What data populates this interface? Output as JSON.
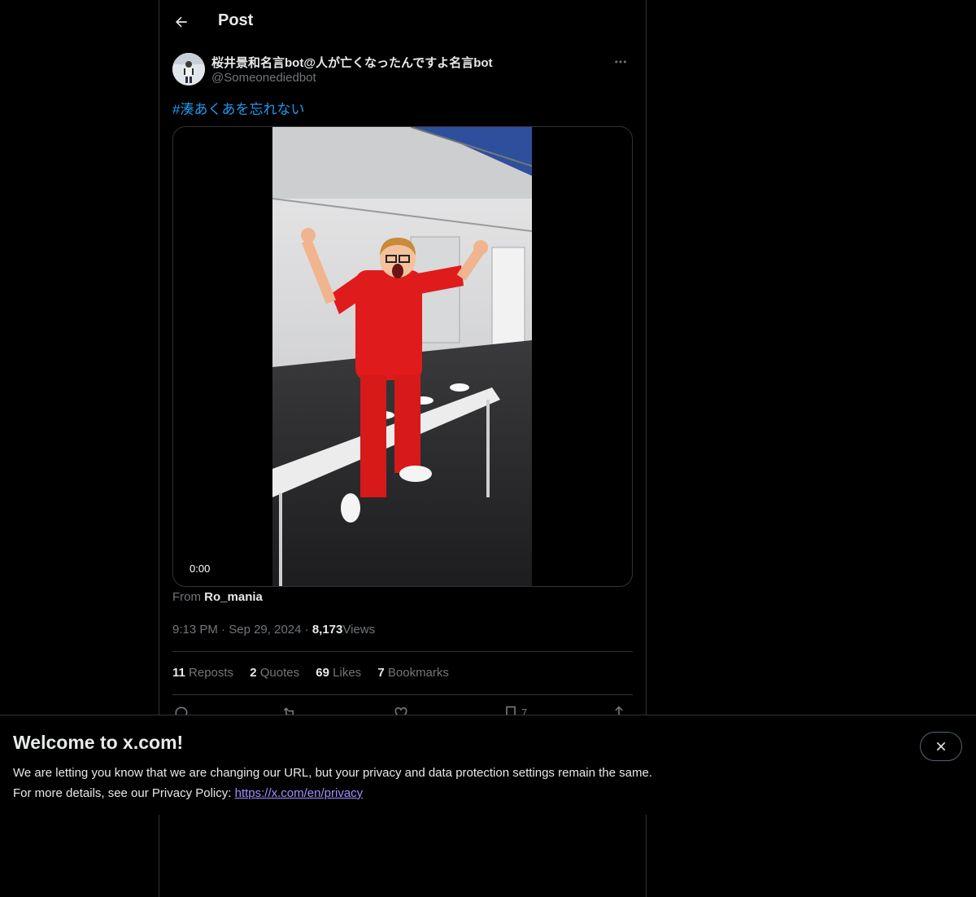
{
  "header": {
    "title": "Post"
  },
  "post": {
    "author_name": "桜井景和名言bot@人が亡くなったんですよ名言bot",
    "author_handle": "@Someonediedbot",
    "hashtag": "#湊あくあを忘れない",
    "video_time": "0:00",
    "source_prefix": "From",
    "source_name": "Ro_mania",
    "time": "9:13 PM",
    "date": "Sep 29, 2024",
    "views_count": "8,173",
    "views_label": "Views",
    "separator": "·",
    "stats": {
      "reposts_count": "11",
      "reposts_label": "Reposts",
      "quotes_count": "2",
      "quotes_label": "Quotes",
      "likes_count": "69",
      "likes_label": "Likes",
      "bookmarks_count": "7",
      "bookmarks_label": "Bookmarks"
    },
    "bookmark_action_count": "7"
  },
  "banner": {
    "title": "Welcome to x.com!",
    "line1": "We are letting you know that we are changing our URL, but your privacy and data protection settings remain the same.",
    "line2_prefix": "For more details, see our Privacy Policy:",
    "link_text": "https://x.com/en/privacy"
  },
  "colors": {
    "background": "#000000",
    "text": "#e7e9ea",
    "muted": "#71767b",
    "link": "#1d9bf0",
    "banner_link": "#a48cff",
    "border": "#2f3336"
  },
  "icons": {
    "back": "arrow-left-icon",
    "more": "more-horizontal-icon",
    "reply": "reply-icon",
    "repost": "repost-icon",
    "like": "heart-icon",
    "bookmark": "bookmark-icon",
    "share": "share-icon",
    "close": "close-icon"
  }
}
